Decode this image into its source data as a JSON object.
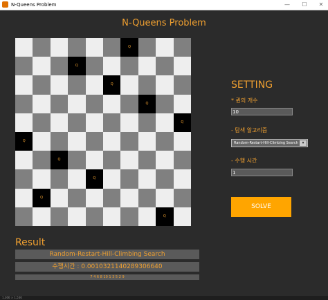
{
  "window": {
    "title": "N-Queens Problem",
    "minimize_glyph": "—",
    "maximize_glyph": "☐",
    "close_glyph": "✕",
    "status_text": "1,366 × 1,536"
  },
  "main_title": "N-Queens Problem",
  "board": {
    "size": 10,
    "queen_glyph": "Q",
    "queens": [
      {
        "row": 0,
        "col": 6
      },
      {
        "row": 1,
        "col": 3
      },
      {
        "row": 2,
        "col": 5
      },
      {
        "row": 3,
        "col": 7
      },
      {
        "row": 4,
        "col": 9
      },
      {
        "row": 5,
        "col": 0
      },
      {
        "row": 6,
        "col": 2
      },
      {
        "row": 7,
        "col": 4
      },
      {
        "row": 8,
        "col": 1
      },
      {
        "row": 9,
        "col": 8
      }
    ],
    "colors": {
      "light": "#eeeeee",
      "dark": "#808080",
      "queen_cell": "#000000",
      "queen_glyph": "#f0a030"
    }
  },
  "setting": {
    "title": "SETTING",
    "queen_count_label": "* 퀸의 개수",
    "queen_count_value": "10",
    "algorithm_label": "- 탐색 알고리즘",
    "algorithm_value": "Random-Restart-Hill-Climbing Search",
    "run_time_label": "- 수행 시간",
    "run_time_value": "1",
    "solve_label": "SOLVE"
  },
  "result": {
    "title": "Result",
    "algorithm": "Random-Restart-Hill-Climbing Search",
    "elapsed": "수행시간 : 0.0010321140289306640",
    "detail": "7 4 6 8 10 1 3 5 2 9"
  },
  "colors": {
    "accent": "#f0a030",
    "background": "#2b2b2b",
    "solve_button": "#ffa500",
    "result_bar": "#5a5a5a"
  }
}
